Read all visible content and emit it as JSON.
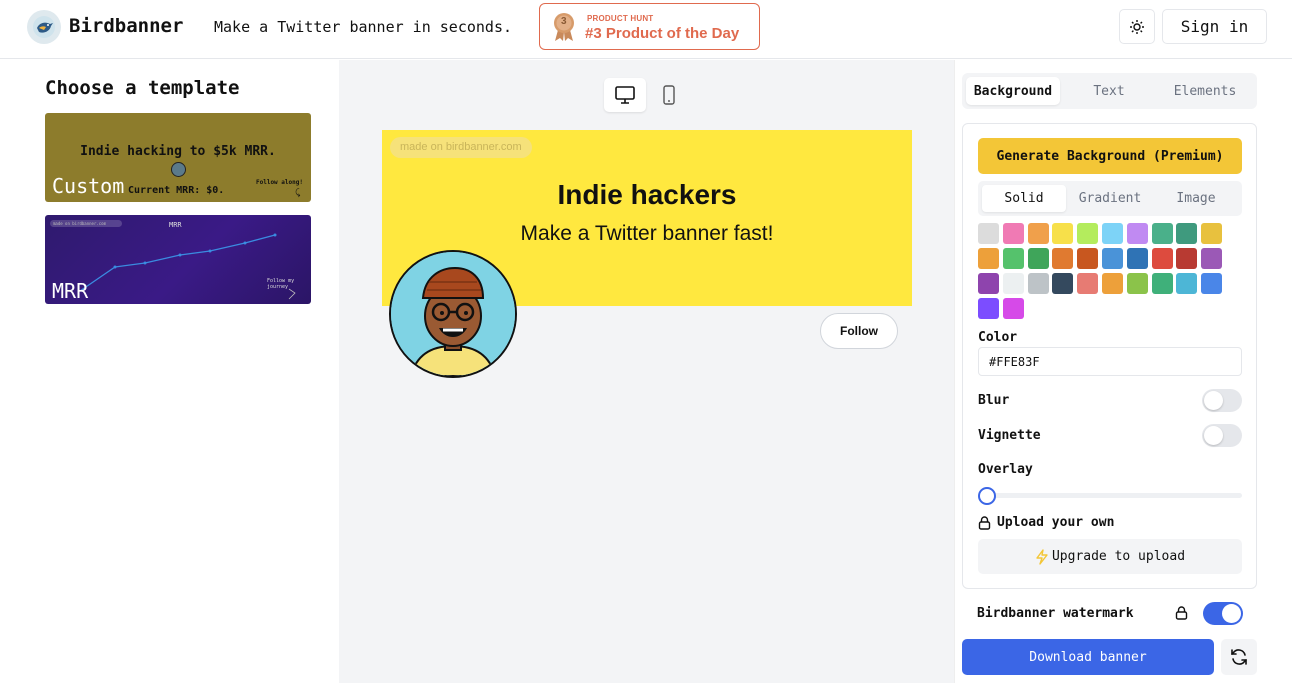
{
  "header": {
    "brand": "Birdbanner",
    "tagline": "Make a Twitter banner in seconds.",
    "product_hunt": {
      "small": "PRODUCT HUNT",
      "big": "#3 Product of the Day",
      "rank": "3"
    },
    "theme_icon": "sun-icon",
    "sign_in": "Sign in"
  },
  "templates": {
    "title": "Choose a template",
    "items": [
      {
        "label": "Custom",
        "preview_title": "Indie hacking to $5k MRR.",
        "preview_sub": "Current MRR: $0.",
        "preview_follow": "Follow along!",
        "preview_arrow": "⤹"
      },
      {
        "label": "MRR",
        "preview_title": "MRR",
        "preview_follow": "Follow my journey",
        "preview_watermark": "made on birdbanner.com"
      }
    ]
  },
  "preview": {
    "device_icons": [
      "desktop-icon",
      "mobile-icon"
    ],
    "banner": {
      "watermark": "made on birdbanner.com",
      "title": "Indie hackers",
      "subtitle": "Make a Twitter banner fast!",
      "bg_color": "#FFE83F"
    },
    "follow": "Follow"
  },
  "panel": {
    "tabs": [
      "Background",
      "Text",
      "Elements"
    ],
    "active_tab": "Background",
    "generate": "Generate Background (Premium)",
    "subtabs": [
      "Solid",
      "Gradient",
      "Image"
    ],
    "active_subtab": "Solid",
    "swatches": [
      "#dcdcdc",
      "#f07ab4",
      "#f0a04b",
      "#f7e04a",
      "#b4ec5d",
      "#7dd3f7",
      "#c08af2",
      "#4ab08a",
      "#3f9a7e",
      "#e8c13e",
      "#eda03a",
      "#55c26c",
      "#3fa55a",
      "#e07a30",
      "#c8571f",
      "#4a93d8",
      "#2f73b5",
      "#dd4b3e",
      "#b83a32",
      "#9b59b6",
      "#8e44ad",
      "#ecf0f1",
      "#bdc3c7",
      "#34495e",
      "#e77b73",
      "#eda03a",
      "#8bc34a",
      "#3fb07a",
      "#4db6d6",
      "#4a86e8",
      "#7c4dff",
      "#d64ae8"
    ],
    "color_label": "Color",
    "color_value": "#FFE83F",
    "blur": "Blur",
    "vignette": "Vignette",
    "overlay": "Overlay",
    "overlay_value": 0,
    "upload_label": "Upload your own",
    "upgrade": "Upgrade to upload",
    "watermark_label": "Birdbanner watermark",
    "download": "Download banner"
  }
}
